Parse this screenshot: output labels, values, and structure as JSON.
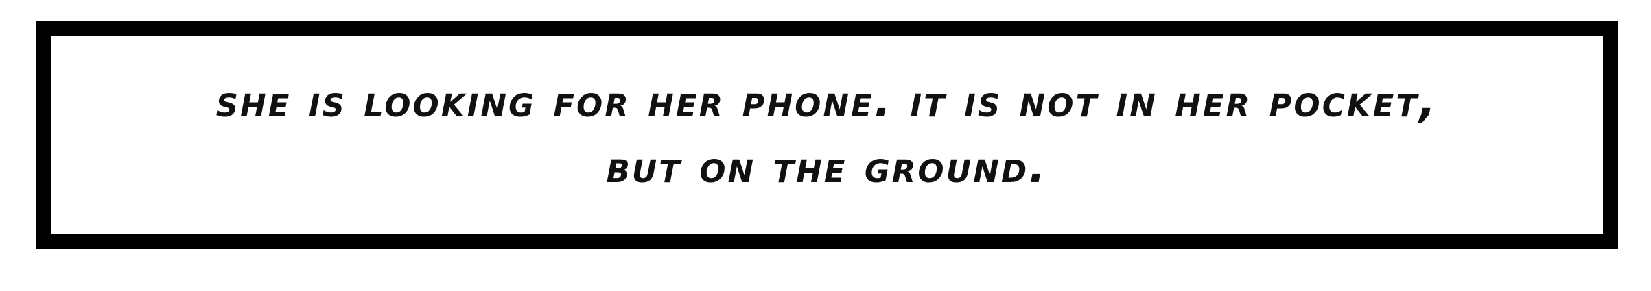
{
  "caption": {
    "line1": "She is looking for her phone. It is not in her pocket,",
    "line2": "but on the ground."
  },
  "colors": {
    "border": "#000000",
    "background": "#ffffff",
    "text": "#111111"
  }
}
